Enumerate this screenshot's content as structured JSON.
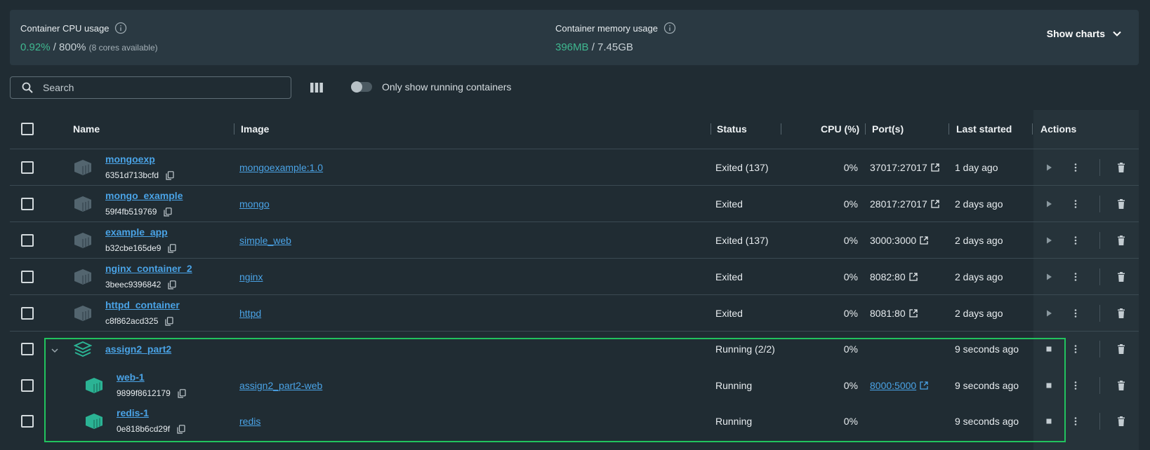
{
  "stats": {
    "cpu_label": "Container CPU usage",
    "cpu_value": "0.92%",
    "cpu_total": "/ 800%",
    "cpu_sub": "(8 cores available)",
    "mem_label": "Container memory usage",
    "mem_value": "396MB",
    "mem_total": "/ 7.45GB",
    "show_charts": "Show charts"
  },
  "toolbar": {
    "search_placeholder": "Search",
    "toggle_label": "Only show running containers",
    "toggle_on": false
  },
  "table": {
    "headers": {
      "name": "Name",
      "image": "Image",
      "status": "Status",
      "cpu": "CPU (%)",
      "ports": "Port(s)",
      "last_started": "Last started",
      "actions": "Actions"
    },
    "rows": [
      {
        "name": "mongoexp",
        "id": "6351d713bcfd",
        "image": "mongoexample:1.0",
        "status": "Exited (137)",
        "cpu": "0%",
        "port": "37017:27017",
        "last": "1 day ago"
      },
      {
        "name": "mongo_example",
        "id": "59f4fb519769",
        "image": "mongo",
        "status": "Exited",
        "cpu": "0%",
        "port": "28017:27017",
        "last": "2 days ago"
      },
      {
        "name": "example_app",
        "id": "b32cbe165de9",
        "image": "simple_web",
        "status": "Exited (137)",
        "cpu": "0%",
        "port": "3000:3000",
        "last": "2 days ago"
      },
      {
        "name": "nginx_container_2",
        "id": "3beec9396842",
        "image": "nginx",
        "status": "Exited",
        "cpu": "0%",
        "port": "8082:80",
        "last": "2 days ago"
      },
      {
        "name": "httpd_container",
        "id": "c8f862acd325",
        "image": "httpd",
        "status": "Exited",
        "cpu": "0%",
        "port": "8081:80",
        "last": "2 days ago"
      }
    ],
    "group": {
      "name": "assign2_part2",
      "status": "Running (2/2)",
      "cpu": "0%",
      "last": "9 seconds ago",
      "children": [
        {
          "name": "web-1",
          "id": "9899f8612179",
          "image": "assign2_part2-web",
          "status": "Running",
          "cpu": "0%",
          "port": "8000:5000",
          "last": "9 seconds ago"
        },
        {
          "name": "redis-1",
          "id": "0e818b6cd29f",
          "image": "redis",
          "status": "Running",
          "cpu": "0%",
          "port": "",
          "last": "9 seconds ago"
        }
      ]
    }
  },
  "colors": {
    "accent": "#3fb890",
    "link": "#4aa3e6",
    "highlight_border": "#21c35e",
    "running_icon": "#2bb394",
    "stopped_icon": "#53656f"
  }
}
